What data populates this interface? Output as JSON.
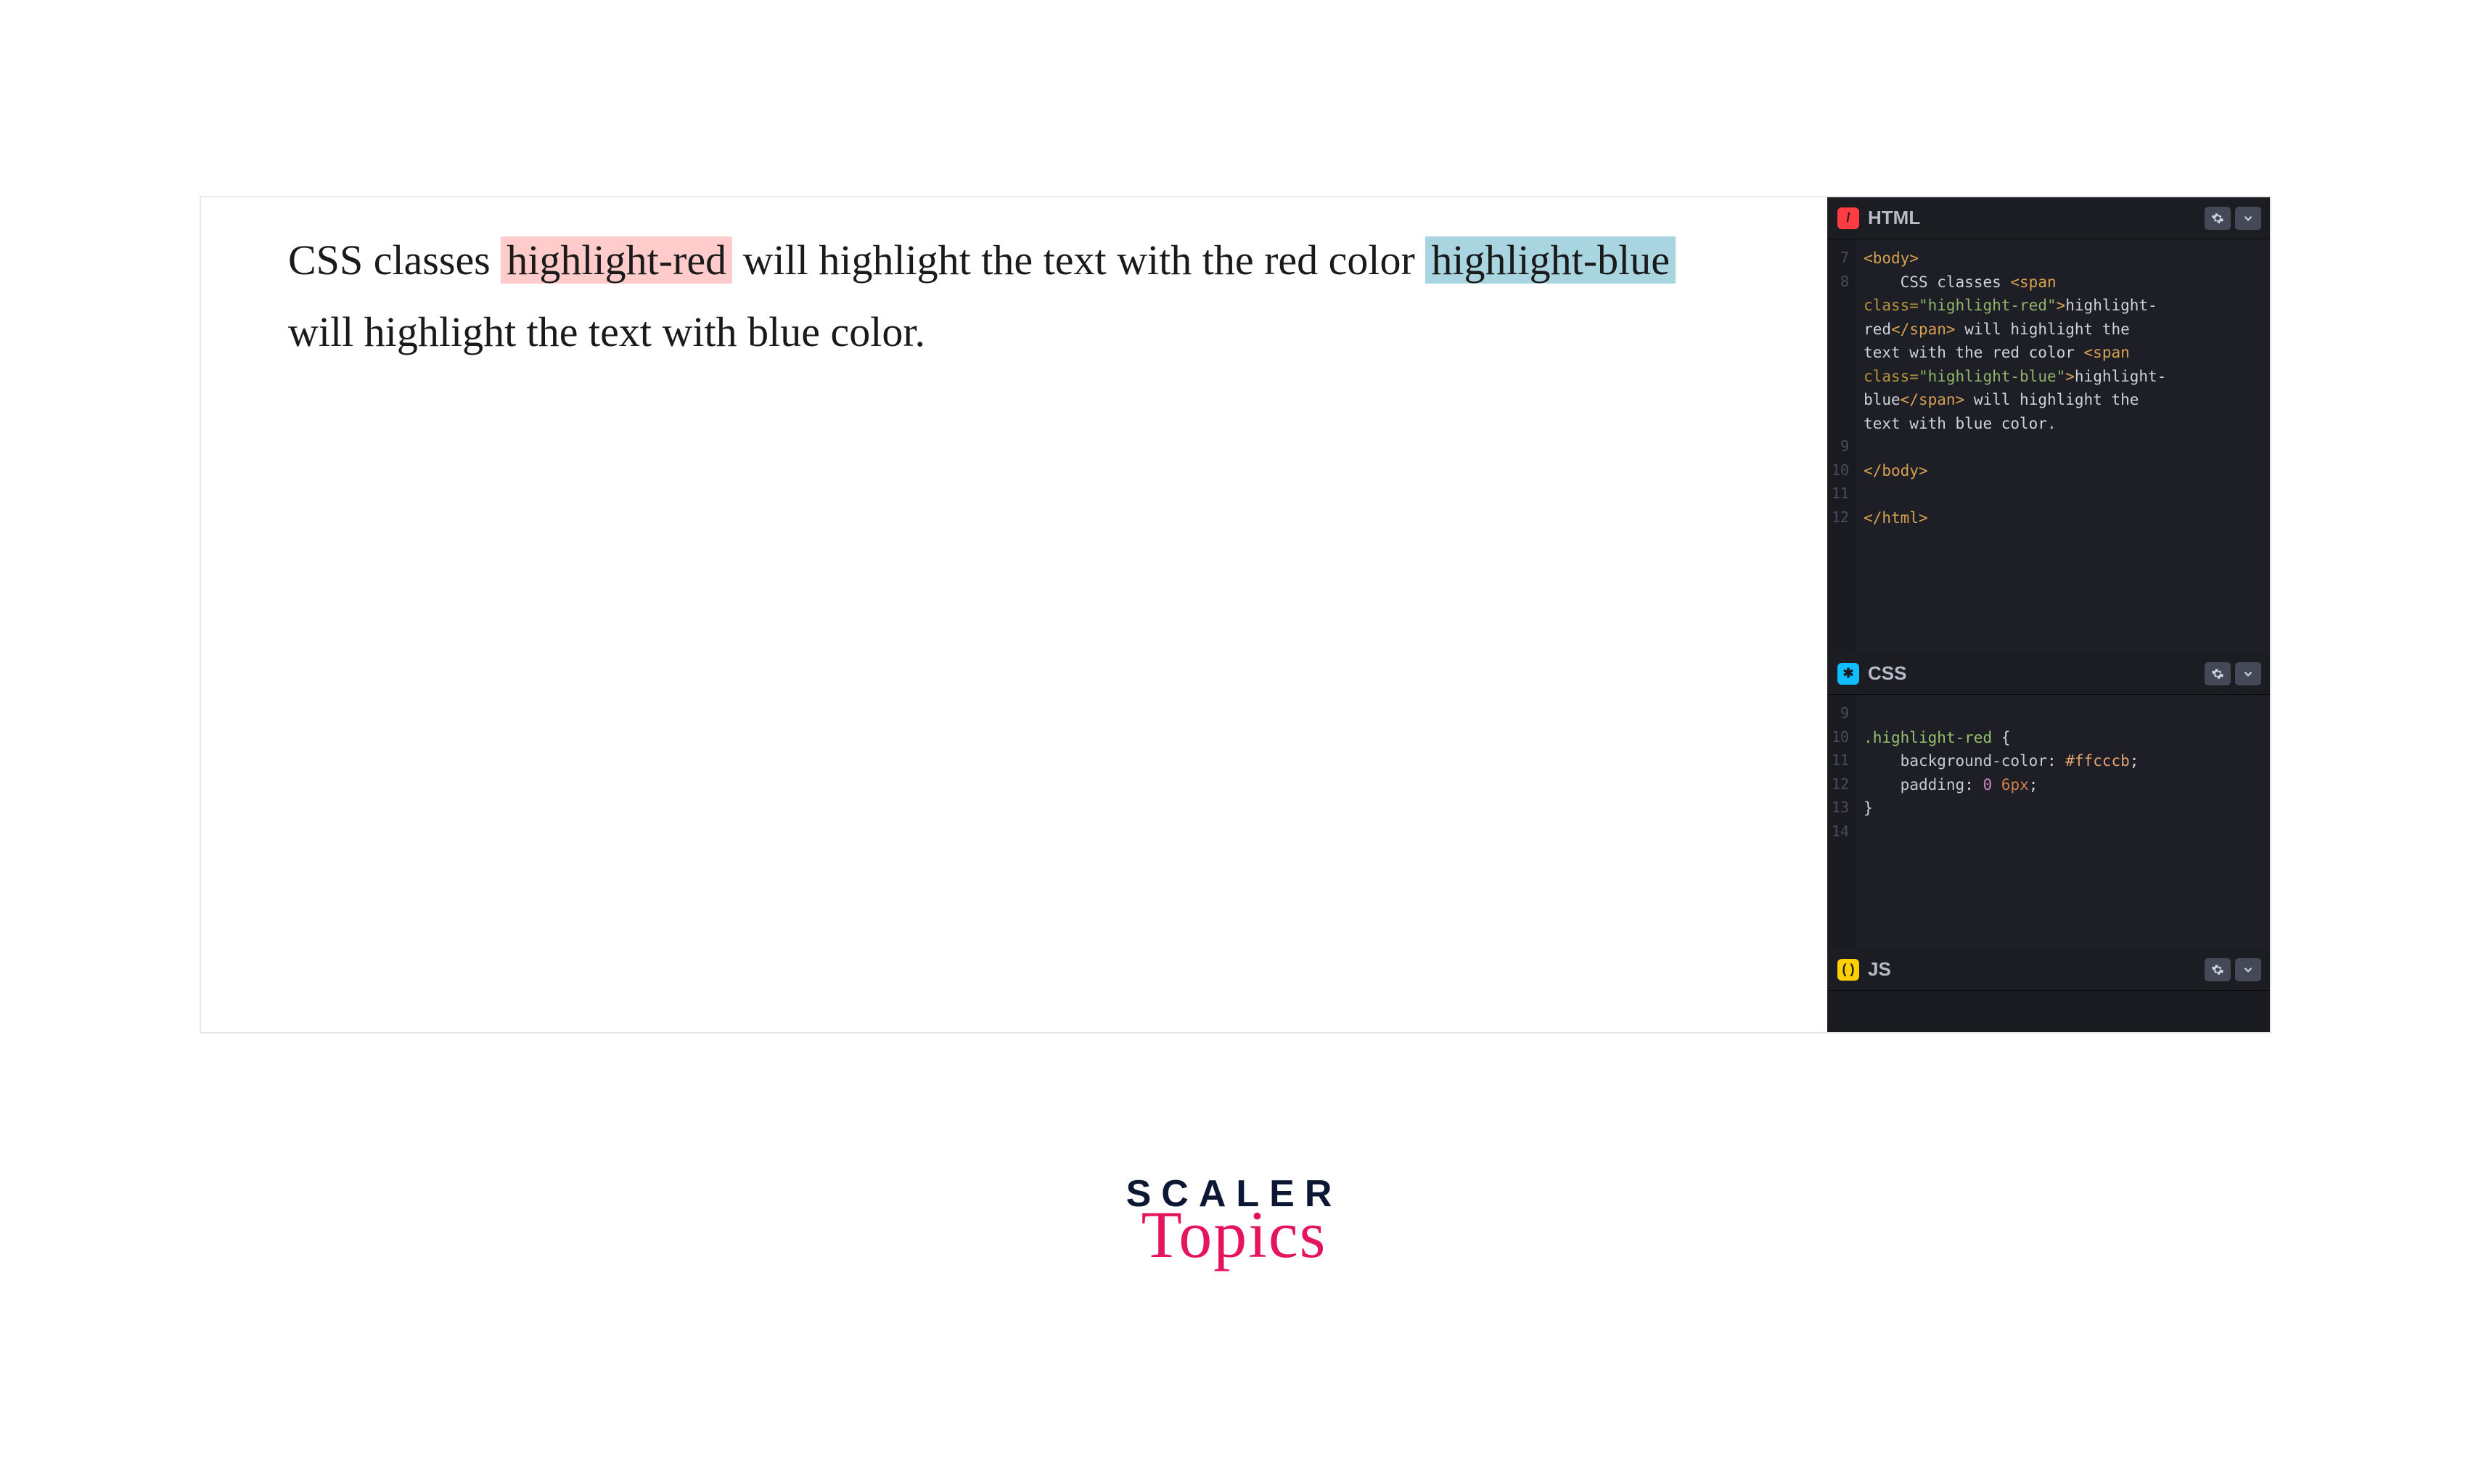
{
  "preview": {
    "t1": "CSS classes ",
    "hl_red": "highlight-red",
    "t2": " will highlight the text with the red color ",
    "hl_blue": "highlight-blue",
    "t3": " will highlight the text with blue color."
  },
  "panels": {
    "html": {
      "title": "HTML",
      "gutter": [
        "7",
        "8",
        "",
        "",
        "",
        "",
        "",
        "",
        "9",
        "10",
        "11",
        "12"
      ],
      "code": {
        "l1": "<body>",
        "l2a": "    CSS classes ",
        "l2b": "<span",
        "l3a": "class=",
        "l3b": "\"highlight-red\"",
        "l3c": ">",
        "l3d": "highlight-",
        "l4a": "red",
        "l4b": "</span>",
        "l4c": " will highlight the ",
        "l5a": "text with the red color ",
        "l5b": "<span",
        "l6a": "class=",
        "l6b": "\"highlight-blue\"",
        "l6c": ">",
        "l6d": "highlight-",
        "l7a": "blue",
        "l7b": "</span>",
        "l7c": " will highlight the ",
        "l8": "text with blue color.",
        "l9": "",
        "l10": "</body>",
        "l11": "",
        "l12": "</html>"
      }
    },
    "css": {
      "title": "CSS",
      "gutter": [
        "9",
        "10",
        "11",
        "12",
        "13",
        "14"
      ],
      "code": {
        "l1": "",
        "l2a": ".highlight-red",
        "l2b": " {",
        "l3a": "    background-color",
        "l3b": ": ",
        "l3c": "#ffcccb",
        "l3d": ";",
        "l4a": "    padding",
        "l4b": ": ",
        "l4c": "0",
        "l4d": " ",
        "l4e": "6px",
        "l4f": ";",
        "l5": "}",
        "l6": ""
      }
    },
    "js": {
      "title": "JS"
    }
  },
  "brand": {
    "line1": "SCALER",
    "line2": "Topics"
  },
  "colors": {
    "highlight_red": "#ffcccb",
    "highlight_blue": "#a8d5df",
    "editor_bg": "#1e1f26",
    "brand_pink": "#e4145f",
    "brand_navy": "#0c1733"
  }
}
